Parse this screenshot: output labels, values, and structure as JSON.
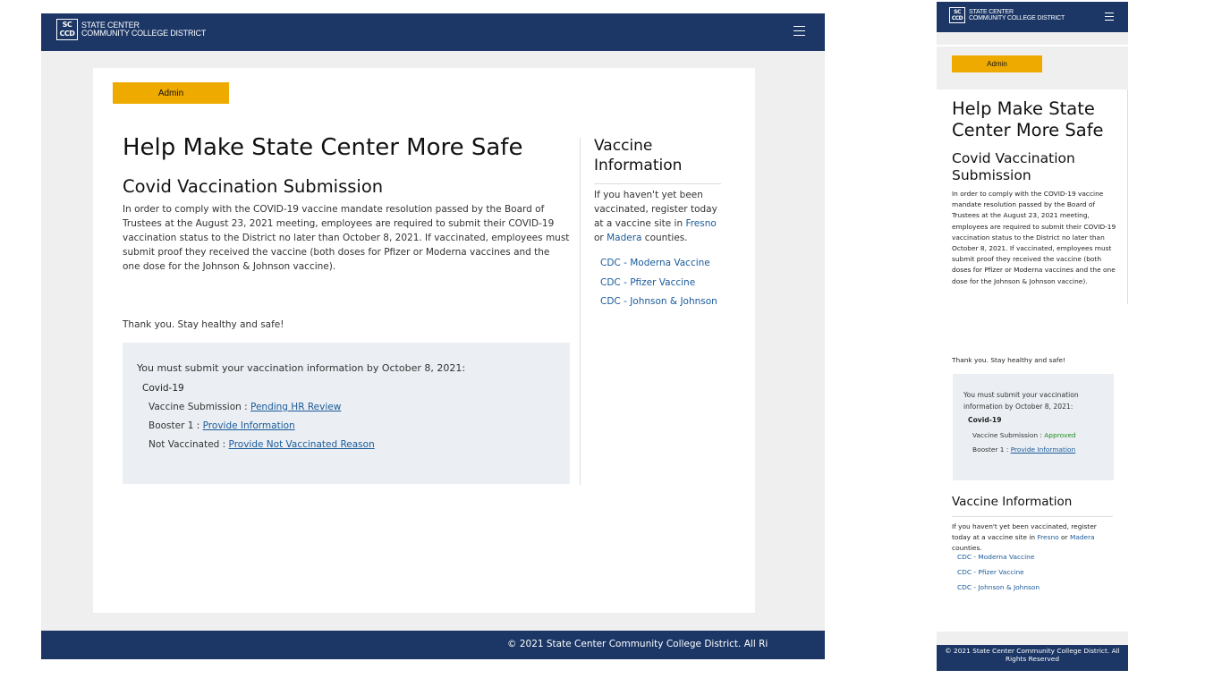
{
  "brand": {
    "logo_mark_top": "SC",
    "logo_mark_bottom": "CCD",
    "name_line1": "STATE CENTER",
    "name_line2": "COMMUNITY COLLEGE DISTRICT"
  },
  "admin_label": "Admin",
  "page_title": "Help Make State Center More Safe",
  "section_title": "Covid Vaccination Submission",
  "intro": "In order to comply with the COVID-19 vaccine mandate resolution passed by the Board of Trustees at the August 23, 2021 meeting, employees are required to submit their COVID-19 vaccination status to the District no later than October 8, 2021. If vaccinated, employees must submit proof they received the vaccine (both doses for Pfizer or Moderna vaccines and the one dose for the Johnson & Johnson vaccine).",
  "thanks": "Thank you. Stay healthy and safe!",
  "submission_box": {
    "deadline_text": "You must submit your vaccination information by October 8, 2021:",
    "category": "Covid-19"
  },
  "desktop_status": {
    "vaccine_label": "Vaccine Submission : ",
    "vaccine_value": "Pending HR Review",
    "booster_label": "Booster 1 : ",
    "booster_value": "Provide Information",
    "not_vacc_label": "Not Vaccinated : ",
    "not_vacc_value": "Provide Not Vaccinated Reason"
  },
  "mobile_status": {
    "vaccine_label": "Vaccine Submission : ",
    "vaccine_value": "Approved",
    "booster_label": "Booster 1 : ",
    "booster_value": "Provide Information"
  },
  "sidebar": {
    "title_line1": "Vaccine",
    "title_line2": "Information",
    "title_full": "Vaccine Information",
    "text_before": "If you haven't yet been vaccinated, register today at a vaccine site in ",
    "fresno": "Fresno",
    "text_or": " or ",
    "madera": "Madera",
    "text_after": " counties.",
    "links": [
      "CDC - Moderna Vaccine",
      "CDC - Pfizer Vaccine",
      "CDC - Johnson & Johnson"
    ]
  },
  "footer": "© 2021 State Center Community College District. All Rights Reserved",
  "colors": {
    "navy": "#1c3766",
    "admin_gold": "#efaa00",
    "link_blue": "#1a5a9a",
    "approved_green": "#1f8a1f",
    "box_bg": "#ebeff3"
  },
  "icons": {
    "menu": "hamburger-menu-icon"
  }
}
